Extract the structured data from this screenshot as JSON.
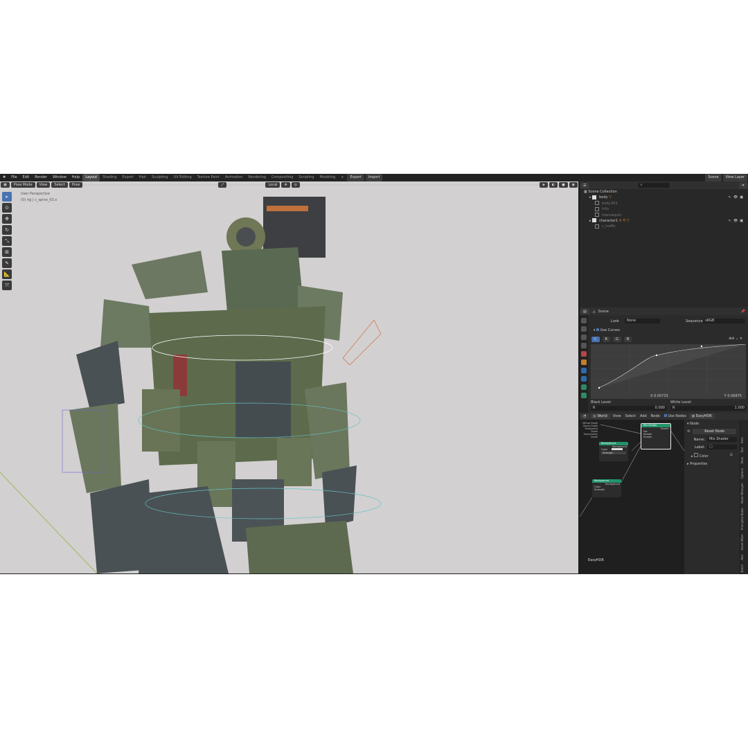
{
  "topbar": {
    "menus": [
      "File",
      "Edit",
      "Render",
      "Window",
      "Help"
    ],
    "workspaces": [
      "Layout",
      "Shading",
      "Export",
      "Hair",
      "Sculpting",
      "UV Editing",
      "Texture Paint",
      "Animation",
      "Rendering",
      "Compositing",
      "Scripting",
      "Modeling"
    ],
    "plus": "+",
    "export_btn": "Export",
    "import_btn": "Import",
    "scene": "Scene",
    "view_layer": "View Layer"
  },
  "viewport": {
    "mode": "Pose Mode",
    "view": "View",
    "select": "Select",
    "pose": "Pose",
    "transform": "Local",
    "info_line1": "User Perspective",
    "info_line2": "(0) rig | c_spine_03.x"
  },
  "outliner": {
    "collection": "Scene Collection",
    "items": [
      "body",
      "body.001",
      "hills",
      "mannequin",
      "character1",
      "c_traffic"
    ]
  },
  "properties": {
    "scene": "Scene",
    "look_label": "Look",
    "look_value": "None",
    "sequencer_label": "Sequencer",
    "sequencer_value": "sRGB",
    "use_curves": "Use Curves",
    "channels": [
      "C",
      "R",
      "G",
      "B"
    ],
    "x_readout": "X 0.05733",
    "y_readout": "Y 0.06875",
    "black_level": "Black Level:",
    "white_level": "White Level:",
    "r_label": "R",
    "black_value": "0.000",
    "white_value": "1.000"
  },
  "node_editor": {
    "world": "World",
    "view": "View",
    "select": "Select",
    "add": "Add",
    "node": "Node",
    "use_nodes": "Use Nodes",
    "world_name": "EasyHDR",
    "footer": "EasyHDR",
    "mix_shader_title": "Mix Shader",
    "bg1_title": "Background",
    "bg2_title": "Background",
    "bg_out": "Background",
    "color": "Color",
    "strength": "Strength",
    "fac": "Fac",
    "shader": "Shader",
    "inputs": [
      "Diffuse Depth",
      "Glossy Depth",
      "Transparent Depth",
      "Transmission Depth"
    ]
  },
  "sidebar": {
    "node_panel": "Node",
    "reset": "Reset Node",
    "name_label": "Name:",
    "name_value": "Mix Shader",
    "label_label": "Label:",
    "color_panel": "Color",
    "properties_panel": "Properties",
    "vtabs": [
      "Batch",
      "Add",
      "Asset Wizer",
      "Principled Baker",
      "Node Wrangler",
      "Options",
      "View",
      "Tool",
      "Item"
    ]
  }
}
